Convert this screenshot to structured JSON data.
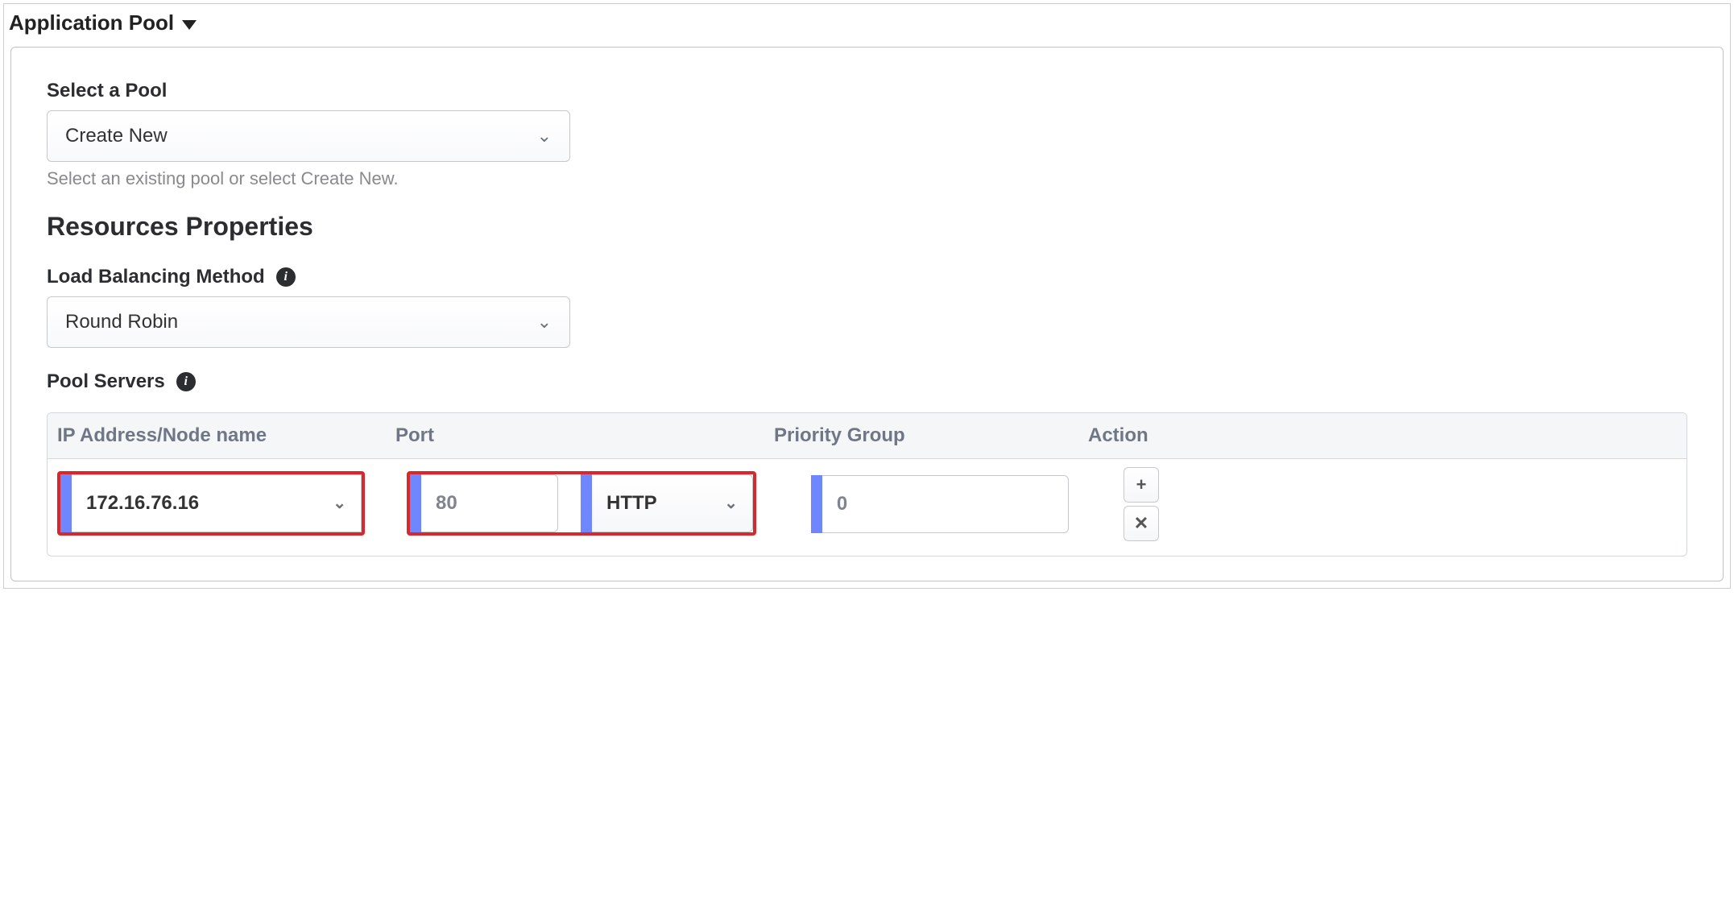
{
  "header": {
    "title": "Application Pool"
  },
  "selectPool": {
    "label": "Select a Pool",
    "value": "Create New",
    "hint": "Select an existing pool or select Create New."
  },
  "resourcesTitle": "Resources Properties",
  "lbMethod": {
    "label": "Load Balancing Method",
    "value": "Round Robin"
  },
  "poolServers": {
    "label": "Pool Servers",
    "columns": {
      "ip": "IP Address/Node name",
      "port": "Port",
      "pg": "Priority Group",
      "action": "Action"
    },
    "rows": [
      {
        "ip": "172.16.76.16",
        "port": "80",
        "proto": "HTTP",
        "pg": "0"
      }
    ]
  },
  "glyphs": {
    "chevDown": "⌄",
    "plus": "+",
    "close": "✕",
    "info": "i"
  }
}
